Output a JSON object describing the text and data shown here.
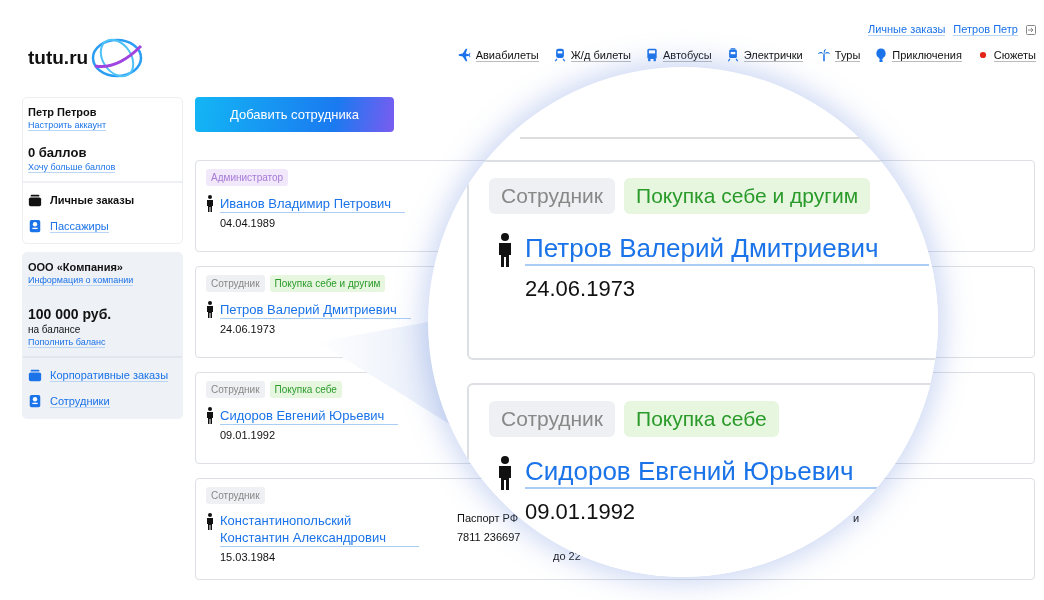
{
  "header": {
    "logo": "tutu.ru",
    "user_links": [
      "Личные заказы",
      "Петров Петр"
    ],
    "nav": [
      "Авиабилеты",
      "Ж/д билеты",
      "Автобусы",
      "Электрички",
      "Туры",
      "Приключения",
      "Сюжеты"
    ]
  },
  "sidebar": {
    "profile": {
      "name": "Петр Петров",
      "settings_link": "Настроить аккаунт",
      "points": "0 баллов",
      "points_link": "Хочу больше баллов",
      "items": [
        {
          "label": "Личные заказы",
          "kind": "current"
        },
        {
          "label": "Пассажиры",
          "kind": "link"
        }
      ]
    },
    "company": {
      "name": "ООО «Компания»",
      "info_link": "Информация о компании",
      "balance": "100 000 руб.",
      "balance_note": "на балансе",
      "top_up_link": "Пополнить баланс",
      "items": [
        {
          "label": "Корпоративные заказы",
          "kind": "link"
        },
        {
          "label": "Сотрудники",
          "kind": "link"
        }
      ]
    }
  },
  "add_button": "Добавить сотрудника",
  "employees": [
    {
      "tags": [
        {
          "label": "Администратор",
          "kind": "admin"
        }
      ],
      "name": "Иванов Владимир Петрович",
      "birth_date": "04.04.1989"
    },
    {
      "tags": [
        {
          "label": "Сотрудник",
          "kind": "role"
        },
        {
          "label": "Покупка себе и другим",
          "kind": "permission"
        }
      ],
      "name": "Петров Валерий Дмитриевич",
      "birth_date": "24.06.1973"
    },
    {
      "tags": [
        {
          "label": "Сотрудник",
          "kind": "role"
        },
        {
          "label": "Покупка себе",
          "kind": "permission"
        }
      ],
      "name": "Сидоров Евгений Юрьевич",
      "birth_date": "09.01.1992"
    },
    {
      "tags": [
        {
          "label": "Сотрудник",
          "kind": "role"
        }
      ],
      "name": "Константинопольский Константин Александрович",
      "birth_date": "15.03.1984",
      "document": {
        "type": "Паспорт РФ",
        "number": "7811 236697"
      },
      "column_3": "до 22",
      "column_4": "и"
    }
  ],
  "magnifier": {
    "employees": [
      {
        "tags": [
          {
            "label": "Сотрудник",
            "kind": "role"
          },
          {
            "label": "Покупка себе и другим",
            "kind": "permission"
          }
        ],
        "name": "Петров Валерий Дмитриевич",
        "birth_date": "24.06.1973"
      },
      {
        "tags": [
          {
            "label": "Сотрудник",
            "kind": "role"
          },
          {
            "label": "Покупка себе",
            "kind": "permission"
          }
        ],
        "name": "Сидоров Евгений Юрьевич",
        "birth_date": "09.01.1992"
      }
    ]
  }
}
